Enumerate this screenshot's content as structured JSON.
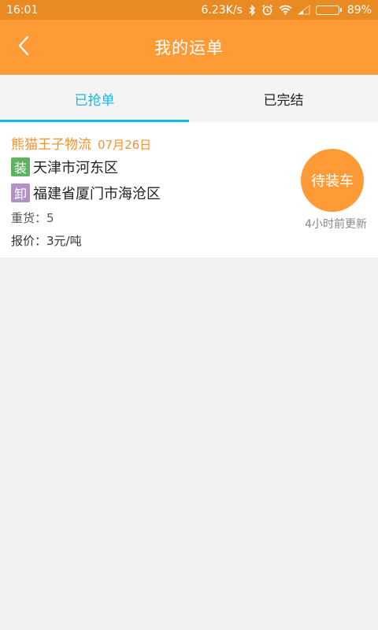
{
  "status_bar": {
    "time": "16:01",
    "network_speed": "6.23K/s",
    "battery_percent": "89%",
    "battery_level": 0.89,
    "icons": [
      "bluetooth-icon",
      "alarm-icon",
      "wifi-icon",
      "signal-icon",
      "battery-icon"
    ]
  },
  "header": {
    "title": "我的运单",
    "back_icon": "back-arrow-icon"
  },
  "tabs": [
    {
      "label": "已抢单",
      "active": true
    },
    {
      "label": "已完结",
      "active": false
    }
  ],
  "order": {
    "company": "熊猫王子物流",
    "date": "07月26日",
    "load_tag": "装",
    "load_address": "天津市河东区",
    "unload_tag": "卸",
    "unload_address": "福建省厦门市海沧区",
    "cargo_label": "重货：",
    "cargo_value": "5",
    "price_label": "报价：",
    "price_value": "3元/吨",
    "status": "待装车",
    "updated": "4小时前更新"
  },
  "colors": {
    "status_bar": "#ea8a22",
    "header": "#ff9b36",
    "tab_active": "#12b9e6",
    "company_text": "#f5922f",
    "load_tag": "#5fb25f",
    "unload_tag": "#b390c7",
    "status_circle": "#ff9b36",
    "background": "#f2f2f2"
  }
}
